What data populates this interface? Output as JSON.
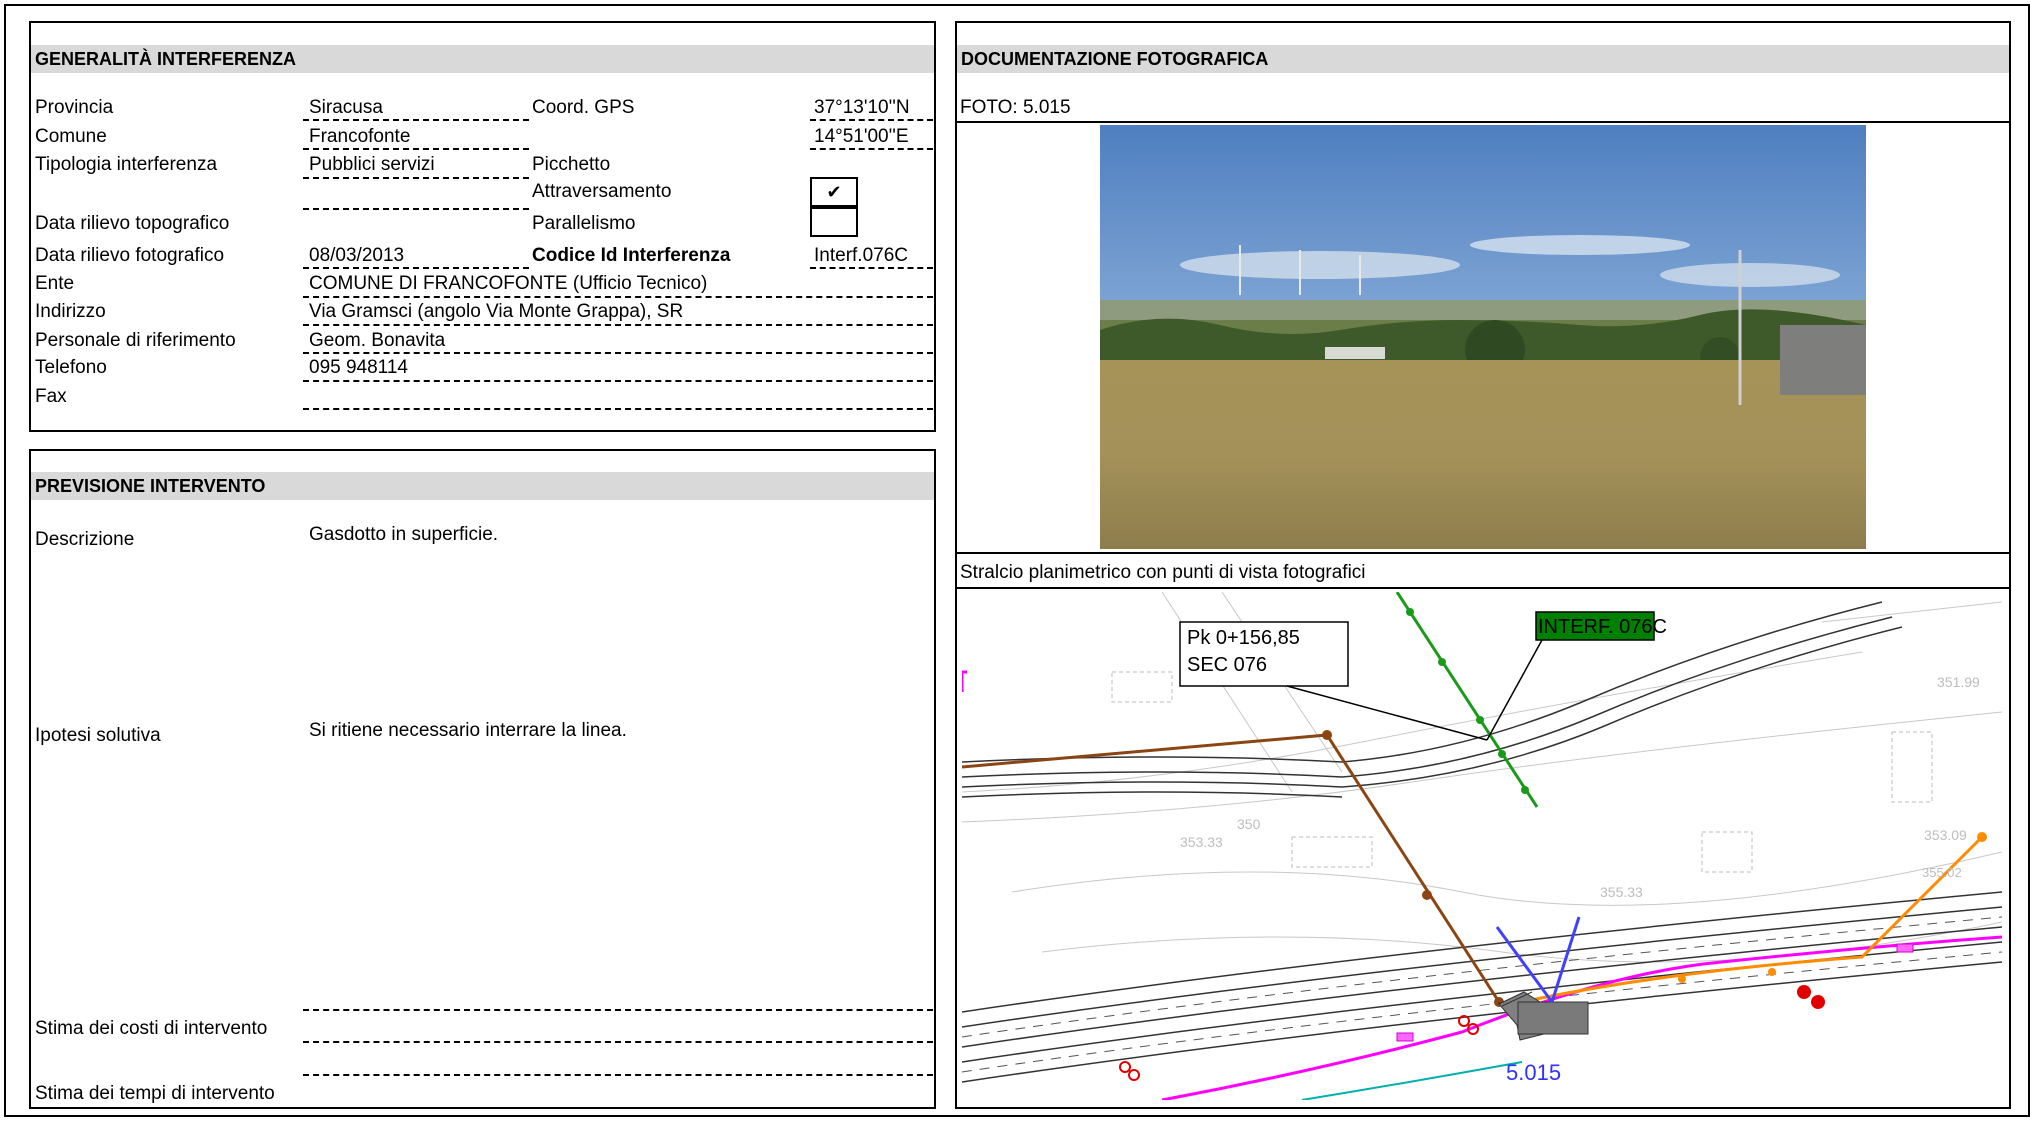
{
  "generalita": {
    "title": "GENERALITÀ  INTERFERENZA",
    "provincia_label": "Provincia",
    "provincia_value": "Siracusa",
    "comune_label": "Comune",
    "comune_value": "Francofonte",
    "tipologia_label": "Tipologia interferenza",
    "tipologia_value": "Pubblici servizi",
    "data_topo_label": "Data rilievo topografico",
    "data_foto_label": "Data rilievo fotografico",
    "data_foto_value": "08/03/2013",
    "ente_label": "Ente",
    "ente_value": "COMUNE DI FRANCOFONTE (Ufficio Tecnico)",
    "indirizzo_label": "Indirizzo",
    "indirizzo_value": "Via Gramsci (angolo Via Monte Grappa), SR",
    "personale_label": "Personale di riferimento",
    "personale_value": "Geom. Bonavita",
    "telefono_label": "Telefono",
    "telefono_value": "095 948114",
    "fax_label": "Fax",
    "coord_label": "Coord. GPS",
    "coord_n": "37°13'10''N",
    "coord_e": "14°51'00''E",
    "picchetto_label": "Picchetto",
    "attraversamento_label": "Attraversamento",
    "attraversamento_check": "✔",
    "parallelismo_label": "Parallelismo",
    "codice_label": "Codice Id Interferenza",
    "codice_value": "Interf.076C"
  },
  "previsione": {
    "title": "PREVISIONE INTERVENTO",
    "descrizione_label": "Descrizione",
    "descrizione_value": "Gasdotto in superficie.",
    "ipotesi_label": "Ipotesi solutiva",
    "ipotesi_value": "Si ritiene necessario interrare la linea.",
    "costi_label": "Stima dei costi di intervento",
    "tempi_label": "Stima dei tempi di intervento"
  },
  "documentazione": {
    "title": "DOCUMENTAZIONE FOTOGRAFICA",
    "foto_label": "FOTO: 5.015",
    "stralcio_label": "Stralcio planimetrico con punti di vista fotografici"
  },
  "map": {
    "pk_line1": "Pk  0+156,85",
    "pk_line2": "SEC 076",
    "interf_label": "INTERF. 076C",
    "photo_point": "5.015",
    "elev_1": "351.99",
    "elev_2": "353.09",
    "elev_3": "355.33",
    "elev_4": "353.33",
    "elev_5": "350",
    "elev_6": "355.02"
  }
}
